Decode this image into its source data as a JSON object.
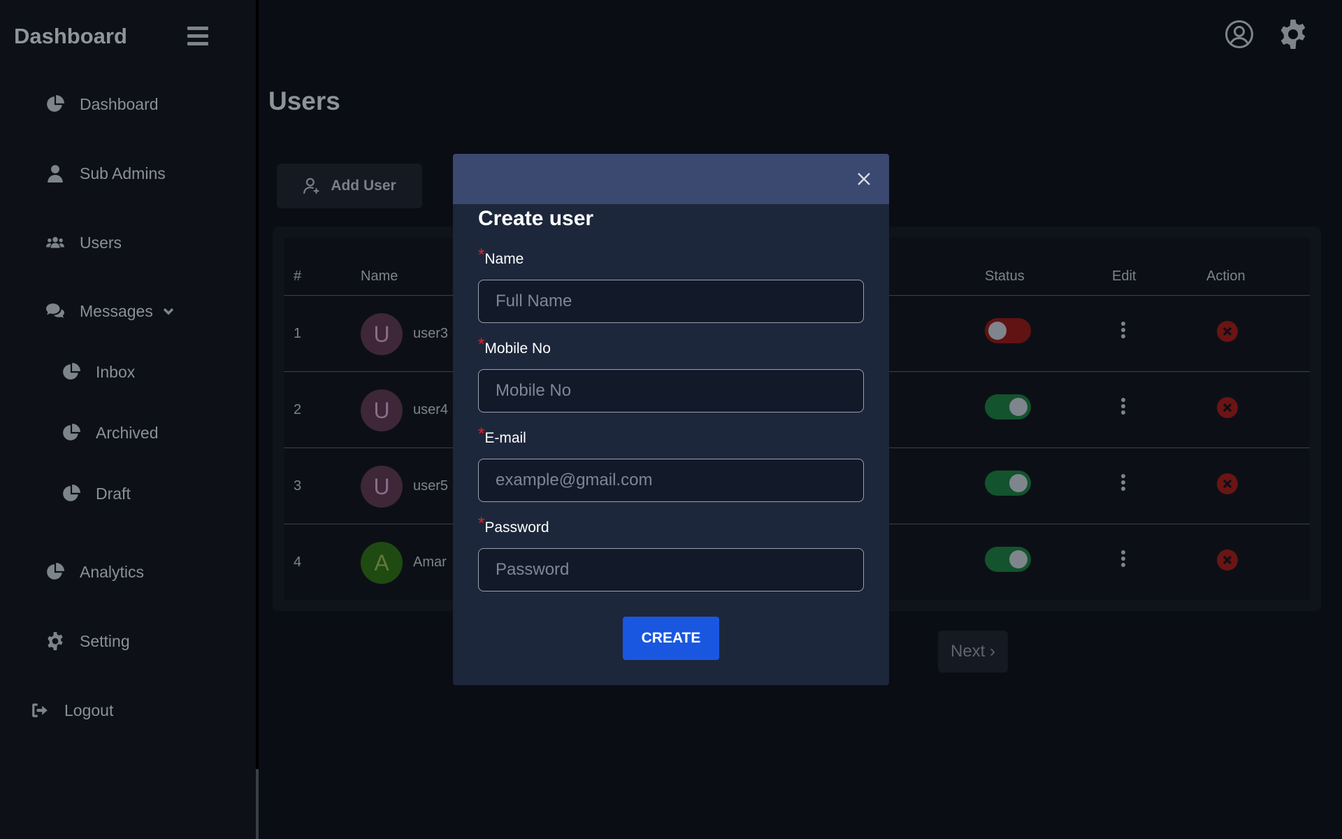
{
  "sidebar": {
    "brand": "Dashboard",
    "items": [
      {
        "label": "Dashboard",
        "icon": "pie-chart-icon"
      },
      {
        "label": "Sub Admins",
        "icon": "user-icon"
      },
      {
        "label": "Users",
        "icon": "users-icon"
      },
      {
        "label": "Messages",
        "icon": "comments-icon"
      },
      {
        "label": "Inbox",
        "icon": "pie-chart-icon"
      },
      {
        "label": "Archived",
        "icon": "pie-chart-icon"
      },
      {
        "label": "Draft",
        "icon": "pie-chart-icon"
      },
      {
        "label": "Analytics",
        "icon": "pie-chart-icon"
      },
      {
        "label": "Setting",
        "icon": "gear-icon"
      },
      {
        "label": "Logout",
        "icon": "logout-icon"
      }
    ]
  },
  "topbar": {
    "icons": [
      "user-circle-icon",
      "gear-icon"
    ]
  },
  "main": {
    "title": "Users",
    "add_user_label": "Add User",
    "table": {
      "headers": [
        "#",
        "Name",
        "Status",
        "Edit",
        "Action"
      ],
      "rows": [
        {
          "num": "1",
          "initial": "U",
          "name": "user3",
          "status": "off"
        },
        {
          "num": "2",
          "initial": "U",
          "name": "user4",
          "status": "on"
        },
        {
          "num": "3",
          "initial": "U",
          "name": "user5",
          "status": "on"
        },
        {
          "num": "4",
          "initial": "A",
          "name": "Amar",
          "status": "on"
        }
      ]
    },
    "next_label": "Next ›"
  },
  "modal": {
    "title": "Create user",
    "required_mark": "*",
    "fields": [
      {
        "label": "Name",
        "placeholder": "Full Name"
      },
      {
        "label": "Mobile No",
        "placeholder": "Mobile No"
      },
      {
        "label": "E-mail",
        "placeholder": "example@gmail.com"
      },
      {
        "label": "Password",
        "placeholder": "Password"
      }
    ],
    "create_label": "CREATE"
  },
  "colors": {
    "accent": "#1a57e0",
    "modal_header": "#3b4870",
    "modal_body": "#1d273b",
    "required": "#e0232b",
    "toggle_on": "#13532d",
    "toggle_off": "#611313"
  }
}
